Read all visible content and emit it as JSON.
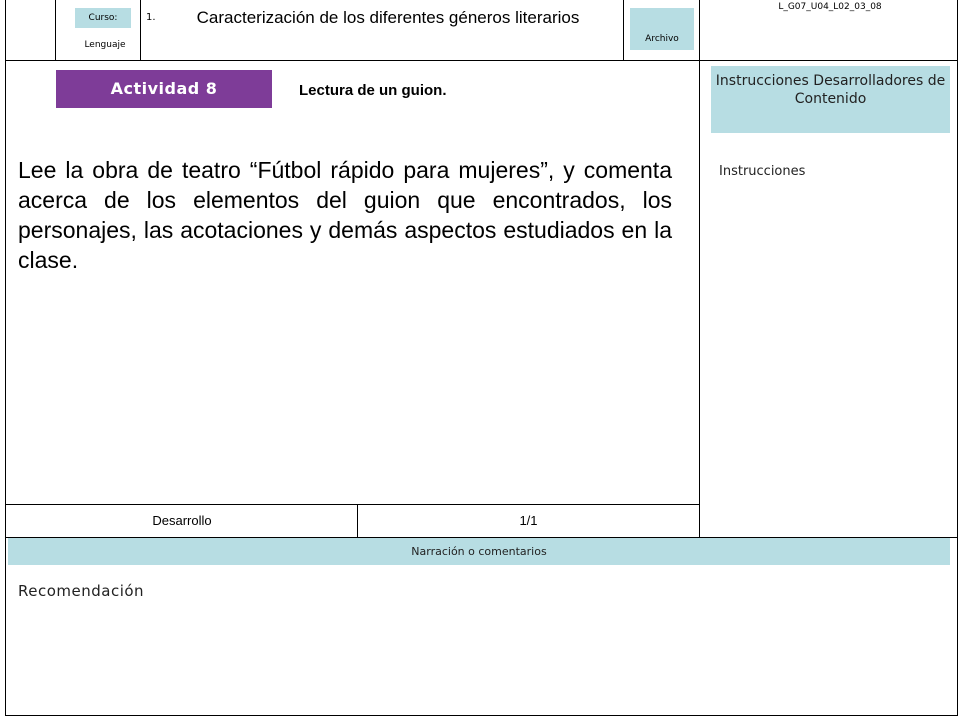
{
  "header": {
    "curso_label": "Curso:",
    "subject": "Lenguaje",
    "item_number": "1.",
    "title": "Caracterización de los diferentes géneros literarios",
    "archivo_label": "Archivo",
    "code": "L_G07_U04_L02_03_08"
  },
  "activity": {
    "badge": "Actividad 8",
    "heading": "Lectura de un guion.",
    "body": "Lee la obra de teatro “Fútbol rápido para mujeres”, y comenta acerca de los elementos del guion que encontrados, los personajes, las acotaciones y demás aspectos estudiados en la clase."
  },
  "side_panel": {
    "header": "Instrucciones Desarrolladores de Contenido",
    "label": "Instrucciones"
  },
  "footer": {
    "section": "Desarrollo",
    "page": "1/1"
  },
  "narration": {
    "bar": "Narración o comentarios",
    "label": "Recomendación"
  },
  "colors": {
    "accent_purple": "#7e3c98",
    "light_blue": "#b7dde3"
  }
}
